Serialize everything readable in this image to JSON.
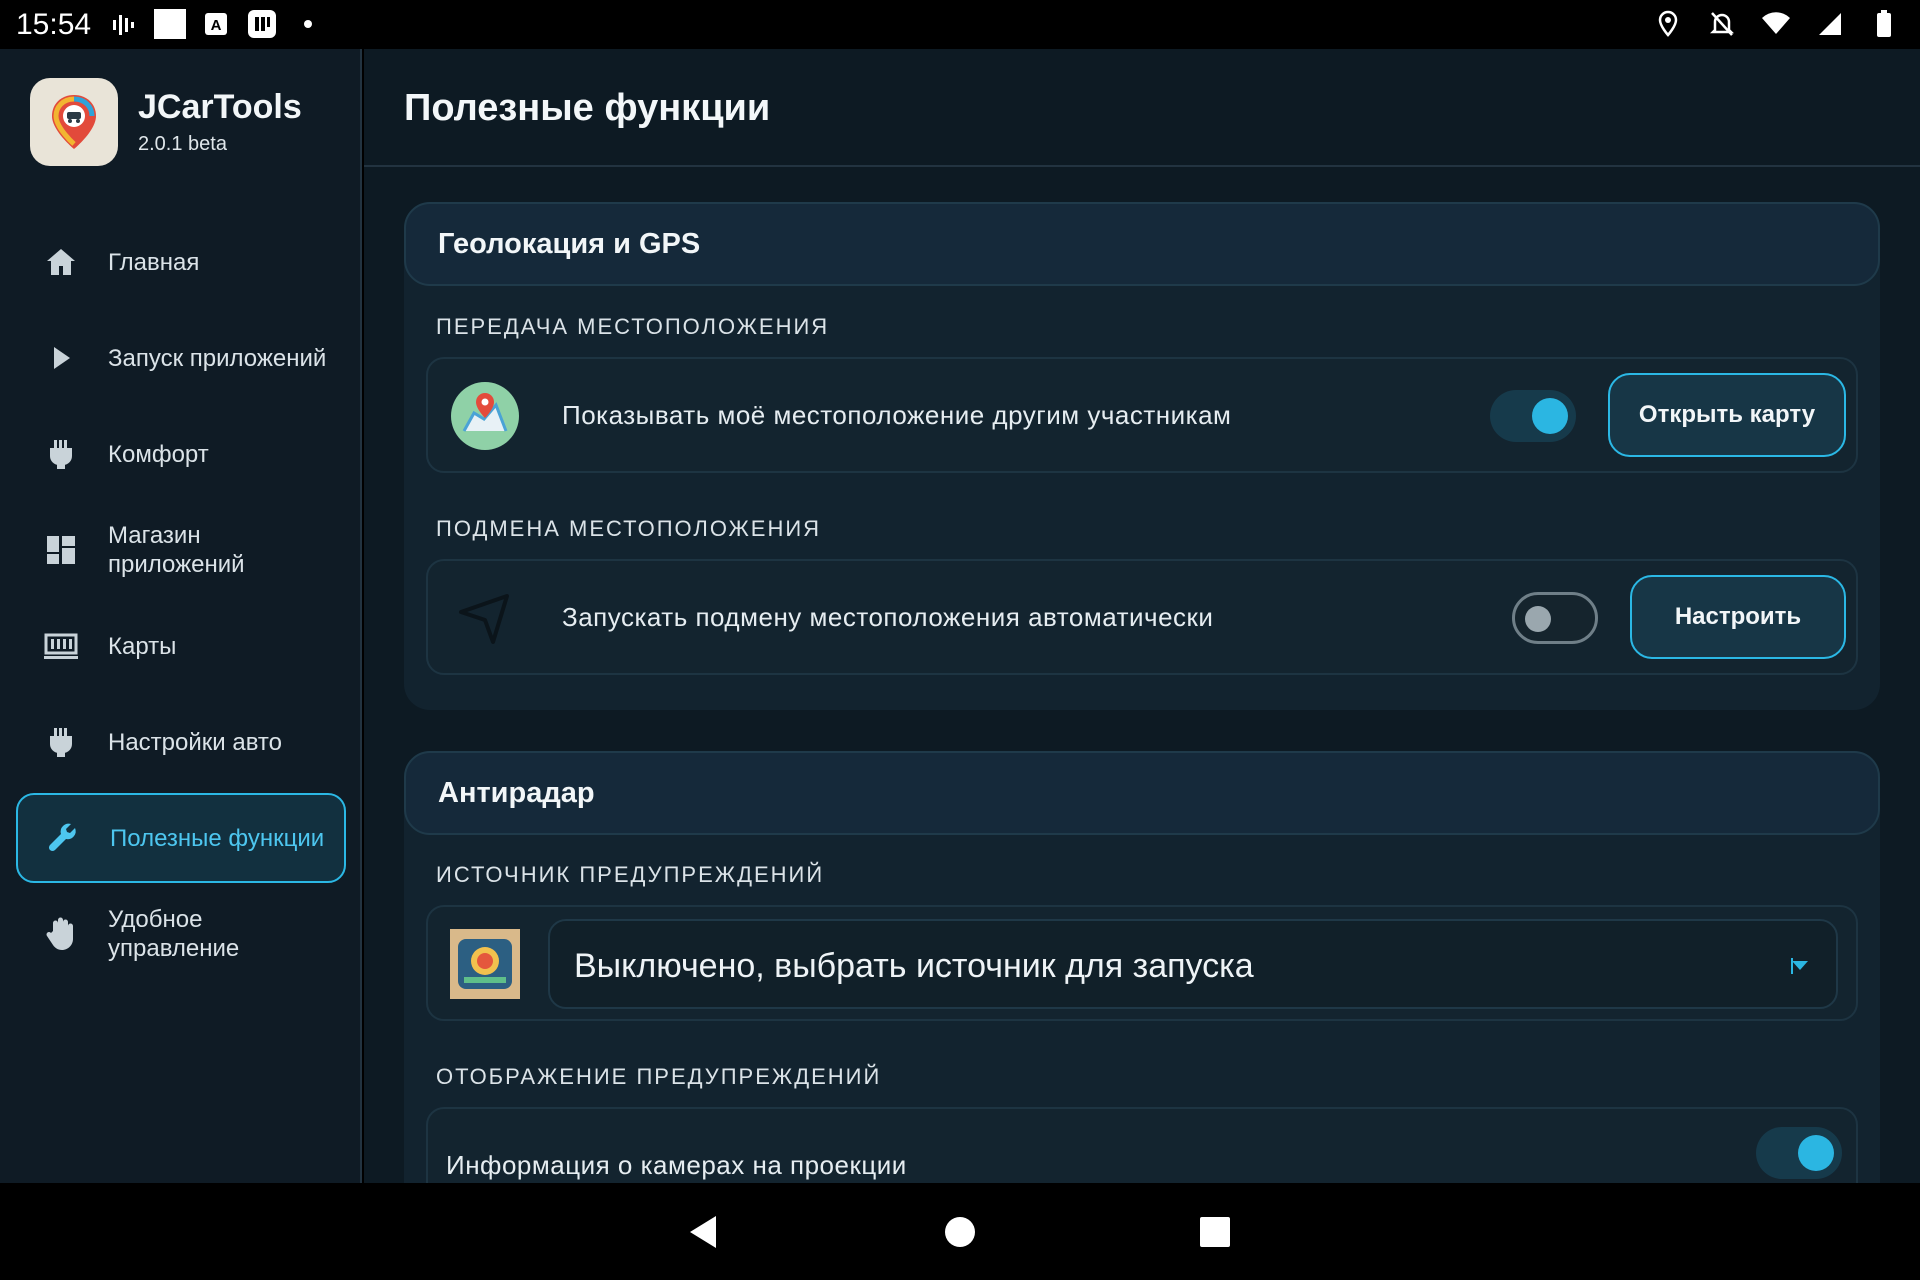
{
  "status_bar": {
    "time": "15:54",
    "left_icons": [
      "signal-bars-icon",
      "square-icon",
      "text-a-icon",
      "app-icon",
      "dot-icon"
    ],
    "right_icons": [
      "location-icon",
      "notifications-off-icon",
      "wifi-icon",
      "cell-signal-icon",
      "battery-icon"
    ]
  },
  "app": {
    "name": "JCarTools",
    "version": "2.0.1 beta"
  },
  "sidebar": {
    "items": [
      {
        "label": "Главная",
        "icon": "home-icon",
        "active": false
      },
      {
        "label": "Запуск приложений",
        "icon": "play-icon",
        "active": false
      },
      {
        "label": "Комфорт",
        "icon": "plug-icon",
        "active": false
      },
      {
        "label": "Магазин приложений",
        "icon": "dashboard-icon",
        "active": false
      },
      {
        "label": "Карты",
        "icon": "map-icon",
        "active": false
      },
      {
        "label": "Настройки авто",
        "icon": "plug-icon",
        "active": false
      },
      {
        "label": "Полезные функции",
        "icon": "wrench-icon",
        "active": true
      },
      {
        "label": "Удобное управление",
        "icon": "hand-icon",
        "active": false
      }
    ]
  },
  "main": {
    "title": "Полезные функции",
    "geo_card": {
      "title": "Геолокация и GPS",
      "share_section": "ПЕРЕДАЧА МЕСТОПОЛОЖЕНИЯ",
      "share_row_text": "Показывать моё местоположение другим участникам",
      "share_toggle": true,
      "open_map_button": "Открыть карту",
      "spoof_section": "ПОДМЕНА МЕСТОПОЛОЖЕНИЯ",
      "spoof_row_text": "Запускать подмену местоположения автоматически",
      "spoof_toggle": false,
      "configure_button": "Настроить"
    },
    "radar_card": {
      "title": "Антирадар",
      "source_section": "ИСТОЧНИК ПРЕДУПРЕЖДЕНИЙ",
      "source_value": "Выключено, выбрать источник для запуска",
      "display_section": "ОТОБРАЖЕНИЕ ПРЕДУПРЕЖДЕНИЙ",
      "camera_info_text": "Информация о камерах на проекции",
      "camera_info_toggle": true
    }
  },
  "colors": {
    "accent": "#2bb8e5",
    "background": "#0d1a23",
    "card": "#12232f"
  },
  "navbar": {
    "icons": [
      "back-icon",
      "home-circle-icon",
      "recents-icon"
    ]
  }
}
